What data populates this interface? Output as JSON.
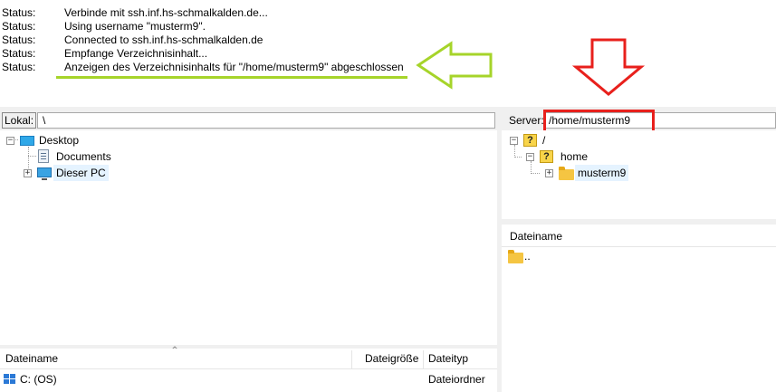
{
  "log": {
    "lines": [
      {
        "label": "Status:",
        "message": "Verbinde mit ssh.inf.hs-schmalkalden.de..."
      },
      {
        "label": "Status:",
        "message": "Using username \"musterm9\"."
      },
      {
        "label": "Status:",
        "message": "Connected to ssh.inf.hs-schmalkalden.de"
      },
      {
        "label": "Status:",
        "message": "Empfange Verzeichnisinhalt..."
      },
      {
        "label": "Status:",
        "message": "Anzeigen des Verzeichnisinhalts für \"/home/musterm9\" abgeschlossen"
      }
    ]
  },
  "local": {
    "path_label": "Lokal:",
    "path_value": "\\",
    "tree": {
      "desktop": "Desktop",
      "documents": "Documents",
      "this_pc": "Dieser PC"
    },
    "columns": {
      "name": "Dateiname",
      "size": "Dateigröße",
      "type": "Dateityp"
    },
    "files": [
      {
        "name": "C: (OS)",
        "type": "Dateiordner"
      }
    ]
  },
  "remote": {
    "path_label": "Server:",
    "path_value": "/home/musterm9",
    "tree": {
      "root": "/",
      "home": "home",
      "user": "musterm9"
    },
    "columns": {
      "name": "Dateiname"
    },
    "files": [
      {
        "name": ".."
      }
    ]
  },
  "annotations": {
    "arrow_green_color": "#a6d42a",
    "arrow_red_color": "#e8201c",
    "arrow_green_direction": "left",
    "arrow_red_direction": "down"
  }
}
